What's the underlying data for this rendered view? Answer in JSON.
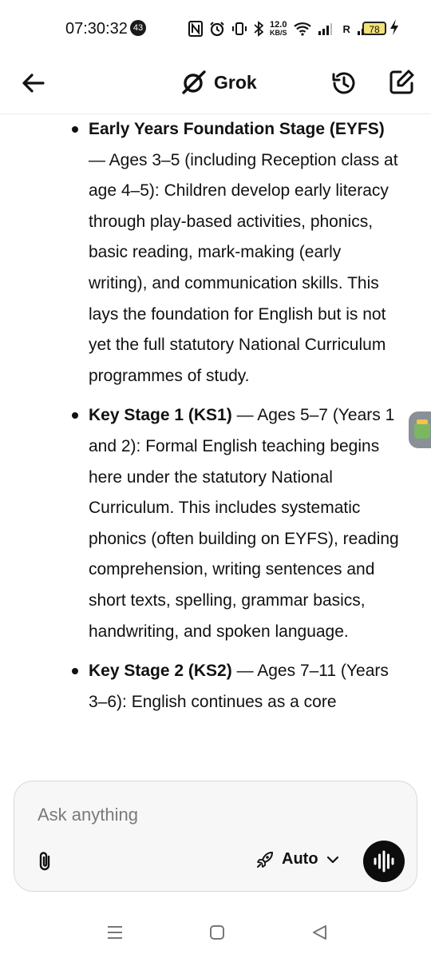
{
  "status_bar": {
    "time": "07:30:32",
    "notification_count": "43",
    "net_speed_value": "12.0",
    "net_speed_unit": "KB/S",
    "carrier_label": "R",
    "battery": "78"
  },
  "header": {
    "title": "Grok"
  },
  "content": {
    "bullets": [
      {
        "heading": "Early Years Foundation Stage (EYFS)",
        "body": " — Ages 3–5 (including Reception class at age 4–5): Children develop early literacy through play-based activities, phonics, basic reading, mark-making (early writing), and communication skills. This lays the foundation for English but is not yet the full statutory National Curriculum programmes of study."
      },
      {
        "heading": "Key Stage 1 (KS1)",
        "body": " — Ages 5–7 (Years 1 and 2): Formal English teaching begins here under the statutory National Curriculum. This includes systematic phonics (often building on EYFS), reading comprehension, writing sentences and short texts, spelling, grammar basics, handwriting, and spoken language."
      },
      {
        "heading": "Key Stage 2 (KS2)",
        "body": " — Ages 7–11 (Years 3–6): English continues as a core"
      }
    ]
  },
  "composer": {
    "placeholder": "Ask anything",
    "mode_label": "Auto"
  },
  "colors": {
    "text": "#111111",
    "composer_bg": "#f7f7f7",
    "voice_button": "#0d0d0d",
    "battery_fill": "#f3e27a"
  }
}
